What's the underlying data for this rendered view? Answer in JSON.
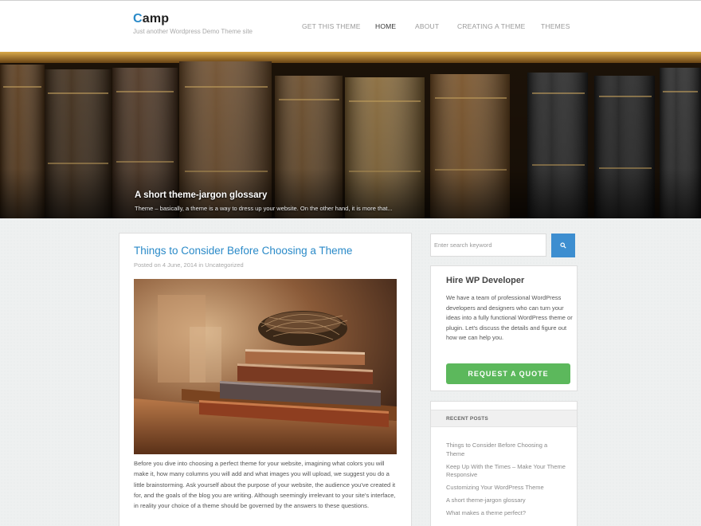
{
  "header": {
    "logo_accent": "C",
    "logo_rest": "amp",
    "tagline": "Just another Wordpress Demo Theme site",
    "nav": [
      {
        "label": "GET THIS THEME"
      },
      {
        "label": "HOME",
        "active": true
      },
      {
        "label": "ABOUT"
      },
      {
        "label": "CREATING A THEME"
      },
      {
        "label": "THEMES"
      }
    ]
  },
  "hero": {
    "title": "A short theme-jargon glossary",
    "excerpt": "Theme – basically, a theme is a way to dress up your website. On the other hand, it is more that..."
  },
  "post": {
    "title": "Things to Consider Before Choosing a Theme",
    "meta_prefix": "Posted on",
    "date": "4 June, 2014",
    "meta_in": "in",
    "category": "Uncategorized",
    "body": "Before you dive into choosing a perfect theme for your website, imagining what colors you will make it, how many columns you will add and what images you will upload, we suggest you do a little brainstorming. Ask yourself about the purpose of your website, the audience you've created it for, and the goals of the blog you are writing. Although seemingly irrelevant to your site's interface, in reality your choice of a theme should be governed by the answers to these questions."
  },
  "sidebar": {
    "search_placeholder": "Enter search keyword",
    "hire": {
      "title": "Hire WP Developer",
      "text": "We have a team of professional WordPress developers and designers who can turn your ideas into a fully functional WordPress theme or plugin. Let's discuss the details and figure out how we can help you.",
      "button": "REQUEST A QUOTE"
    },
    "recent": {
      "heading": "RECENT POSTS",
      "items": [
        {
          "label": "Things to Consider Before Choosing a Theme"
        },
        {
          "label": "Keep Up With the Times – Make Your Theme Responsive"
        },
        {
          "label": "Customizing Your WordPress Theme"
        },
        {
          "label": "A short theme-jargon glossary"
        },
        {
          "label": "What makes a theme perfect?"
        }
      ]
    }
  },
  "colors": {
    "accent": "#2a8ac8",
    "button_green": "#5cb85c",
    "search_blue": "#3d8ed0"
  }
}
